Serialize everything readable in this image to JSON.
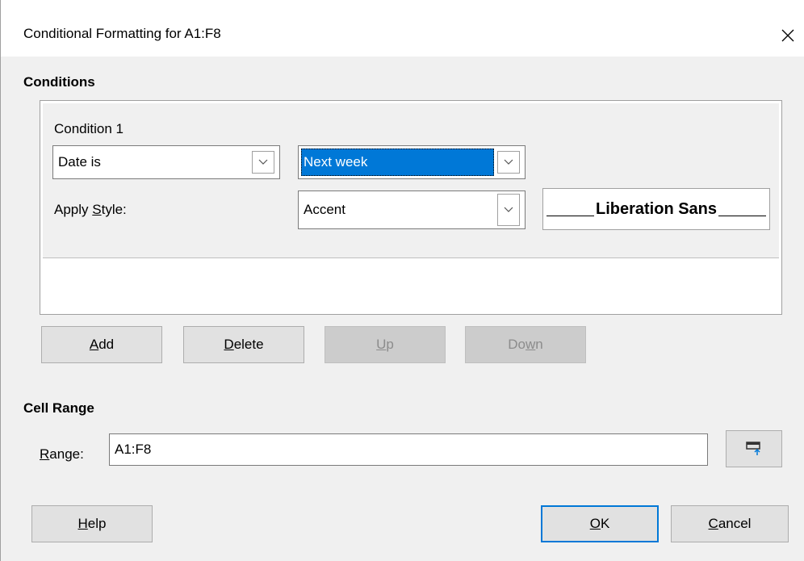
{
  "window": {
    "title": "Conditional Formatting for A1:F8",
    "close_icon": "close-icon"
  },
  "conditions": {
    "heading": "Conditions",
    "items": [
      {
        "title": "Condition 1",
        "type_value": "Date is",
        "date_value": "Next week",
        "apply_style_label_pre": "Apply ",
        "apply_style_label_accel": "S",
        "apply_style_label_post": "tyle:",
        "style_value": "Accent",
        "preview_text": "Liberation Sans"
      }
    ]
  },
  "buttons": {
    "add": {
      "accel": "A",
      "rest": "dd"
    },
    "delete": {
      "accel": "D",
      "rest": "elete"
    },
    "up": {
      "accel": "U",
      "rest": "p"
    },
    "down": {
      "pre": "Do",
      "accel": "w",
      "rest": "n"
    }
  },
  "cell_range": {
    "heading": "Cell Range",
    "label_accel": "R",
    "label_rest": "ange:",
    "value": "A1:F8",
    "shrink_icon": "shrink-dialog-icon"
  },
  "footer": {
    "help": {
      "accel": "H",
      "rest": "elp"
    },
    "ok": {
      "accel": "O",
      "rest": "K"
    },
    "cancel": {
      "accel": "C",
      "rest": "ancel"
    }
  },
  "colors": {
    "accent": "#0078d7",
    "dialog_bg": "#f0f0f0",
    "button_bg": "#e1e1e1",
    "disabled_button_bg": "#cccccc"
  }
}
